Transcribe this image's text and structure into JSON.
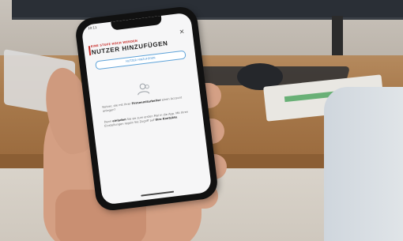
{
  "status": {
    "time": "10:11"
  },
  "screen": {
    "close_icon": "close-icon",
    "kicker": "EINE STUFE HOCH WERDEN",
    "title": "NUTZER HINZUFÜGEN",
    "add_button_label": "NUTZER HINZUFÜGEN",
    "user_icon": "users-icon",
    "para1_prefix": "Nutzer, die mit Ihrer ",
    "para1_bold": "Firmenmitarbeiter",
    "para1_suffix": " einen Account anlegen?",
    "para2_prefix": "Dann ",
    "para2_bold1": "einladen",
    "para2_mid": " Sie sie zum ersten Mal in die App. Mit Ihren Einstellungen regeln Sie Zugriff auf ",
    "para2_bold2": "Ihre Kontakte",
    "para2_suffix": "."
  },
  "colors": {
    "accent_red": "#c8312e",
    "button_blue": "#3b8bd0"
  }
}
